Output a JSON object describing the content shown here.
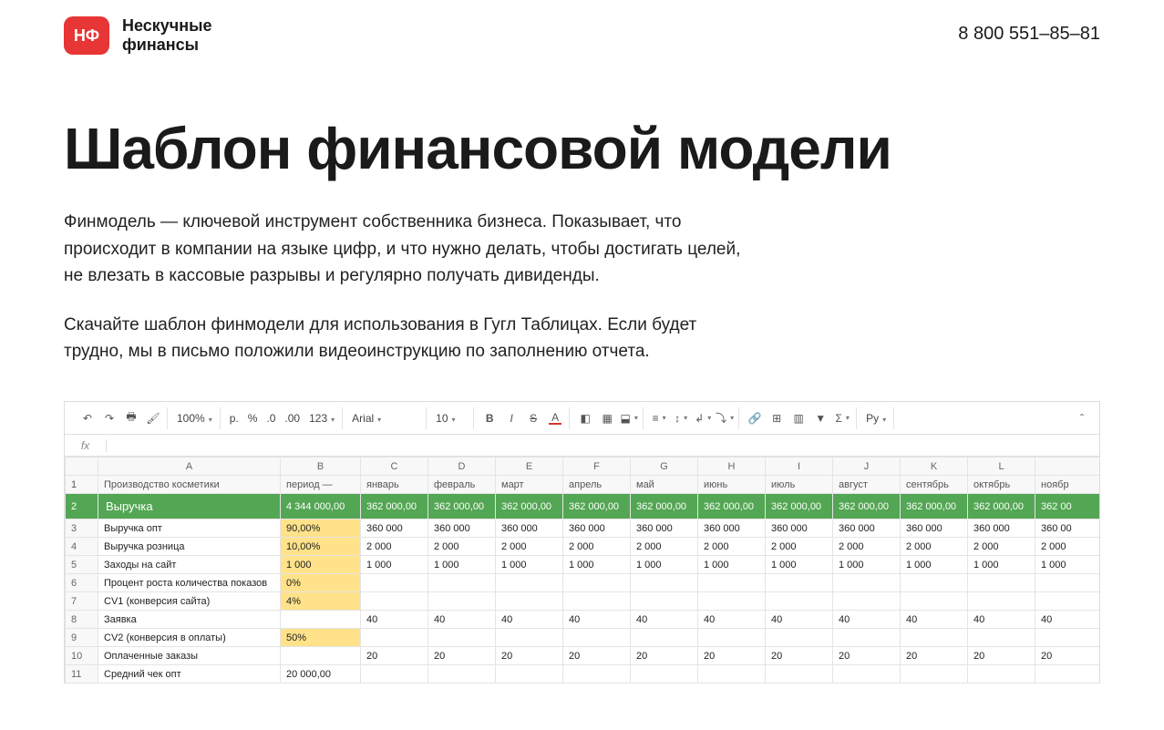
{
  "header": {
    "logo_badge": "НФ",
    "logo_text_line1": "Нескучные",
    "logo_text_line2": "финансы",
    "phone": "8 800 551–85–81"
  },
  "page": {
    "title": "Шаблон финансовой модели",
    "para1": "Финмодель — ключевой инструмент собственника бизнеса. Показывает, что происходит в компании на языке цифр, и что нужно делать, чтобы достигать целей, не влезать в кассовые разрывы и регулярно получать дивиденды.",
    "para2": "Скачайте шаблон финмодели для использования в Гугл Таблицах. Если будет трудно, мы в письмо положили видеоинструкцию по заполнению отчета."
  },
  "toolbar": {
    "zoom": "100%",
    "currency": "р.",
    "percent": "%",
    "dec_dec": ".0",
    "dec_inc": ".00",
    "format": "123",
    "font": "Arial",
    "size": "10",
    "ру": "Ру"
  },
  "sheet": {
    "fx": "fx",
    "col_letters": [
      "",
      "A",
      "B",
      "C",
      "D",
      "E",
      "F",
      "G",
      "H",
      "I",
      "J",
      "K",
      "L",
      ""
    ],
    "rows": [
      {
        "num": "1",
        "class": "hdr-row",
        "cells": [
          "Производство косметики",
          "период —",
          "январь",
          "февраль",
          "март",
          "апрель",
          "май",
          "июнь",
          "июль",
          "август",
          "сентябрь",
          "октябрь",
          "ноябр"
        ]
      },
      {
        "num": "2",
        "class": "revenue",
        "cells": [
          "Выручка",
          "4 344 000,00",
          "362 000,00",
          "362 000,00",
          "362 000,00",
          "362 000,00",
          "362 000,00",
          "362 000,00",
          "362 000,00",
          "362 000,00",
          "362 000,00",
          "362 000,00",
          "362 00"
        ]
      },
      {
        "num": "3",
        "class": "",
        "yellow_b": true,
        "cells": [
          "Выручка опт",
          "90,00%",
          "360 000",
          "360 000",
          "360 000",
          "360 000",
          "360 000",
          "360 000",
          "360 000",
          "360 000",
          "360 000",
          "360 000",
          "360 00"
        ]
      },
      {
        "num": "4",
        "class": "",
        "yellow_b": true,
        "cells": [
          "Выручка розница",
          "10,00%",
          "2 000",
          "2 000",
          "2 000",
          "2 000",
          "2 000",
          "2 000",
          "2 000",
          "2 000",
          "2 000",
          "2 000",
          "2 000"
        ]
      },
      {
        "num": "5",
        "class": "",
        "yellow_b": true,
        "cells": [
          "Заходы на сайт",
          "1 000",
          "1 000",
          "1 000",
          "1 000",
          "1 000",
          "1 000",
          "1 000",
          "1 000",
          "1 000",
          "1 000",
          "1 000",
          "1 000"
        ]
      },
      {
        "num": "6",
        "class": "",
        "yellow_b": true,
        "cells": [
          "Процент роста количества показов",
          "0%",
          "",
          "",
          "",
          "",
          "",
          "",
          "",
          "",
          "",
          "",
          ""
        ]
      },
      {
        "num": "7",
        "class": "",
        "yellow_b": true,
        "cells": [
          "CV1 (конверсия сайта)",
          "4%",
          "",
          "",
          "",
          "",
          "",
          "",
          "",
          "",
          "",
          "",
          ""
        ]
      },
      {
        "num": "8",
        "class": "",
        "cells": [
          "Заявка",
          "",
          "40",
          "40",
          "40",
          "40",
          "40",
          "40",
          "40",
          "40",
          "40",
          "40",
          "40"
        ]
      },
      {
        "num": "9",
        "class": "",
        "yellow_b": true,
        "cells": [
          "CV2 (конверсия в оплаты)",
          "50%",
          "",
          "",
          "",
          "",
          "",
          "",
          "",
          "",
          "",
          "",
          ""
        ]
      },
      {
        "num": "10",
        "class": "",
        "cells": [
          "Оплаченные заказы",
          "",
          "20",
          "20",
          "20",
          "20",
          "20",
          "20",
          "20",
          "20",
          "20",
          "20",
          "20"
        ]
      },
      {
        "num": "11",
        "class": "",
        "cells": [
          "Средний чек опт",
          "20 000,00",
          "",
          "",
          "",
          "",
          "",
          "",
          "",
          "",
          "",
          "",
          ""
        ]
      }
    ]
  }
}
